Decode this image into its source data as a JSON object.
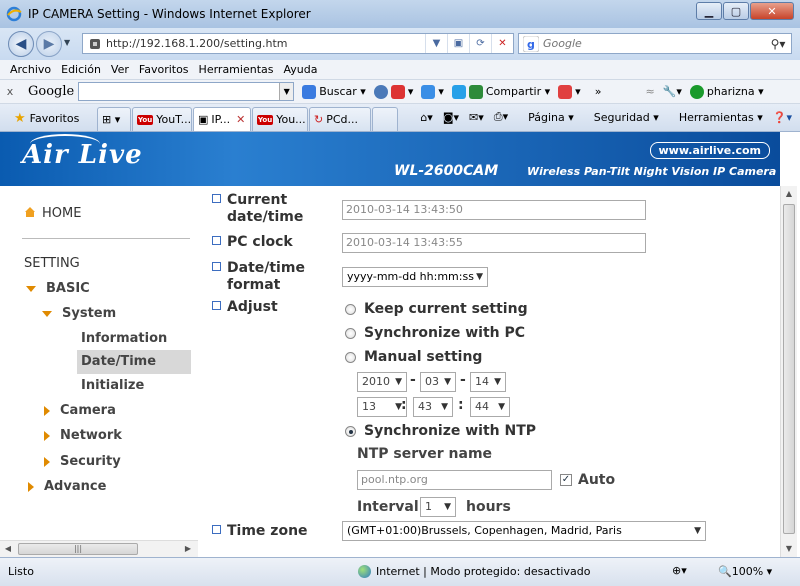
{
  "window": {
    "title": "IP CAMERA Setting - Windows Internet Explorer"
  },
  "address": {
    "url": "http://192.168.1.200/setting.htm",
    "search_placeholder": "Google"
  },
  "menu": [
    "Archivo",
    "Edición",
    "Ver",
    "Favoritos",
    "Herramientas",
    "Ayuda"
  ],
  "google_toolbar": {
    "logo": "Google",
    "buscar": "Buscar",
    "compartir": "Compartir",
    "user": "pharizna"
  },
  "favorites": {
    "label": "Favoritos",
    "tabs": [
      "YouT...",
      "IP...",
      "You...",
      "PCd..."
    ],
    "cmd": [
      "Página",
      "Seguridad",
      "Herramientas"
    ]
  },
  "banner": {
    "logo": "Air Live",
    "site": "www.airlive.com",
    "model": "WL-2600CAM",
    "desc": "Wireless Pan-Tilt Night Vision IP Camera"
  },
  "sidebar": {
    "home": "HOME",
    "setting": "SETTING",
    "basic": "BASIC",
    "system": "System",
    "information": "Information",
    "datetime": "Date/Time",
    "initialize": "Initialize",
    "camera": "Camera",
    "network": "Network",
    "security": "Security",
    "advance": "Advance"
  },
  "form": {
    "current_label_1": "Current",
    "current_label_2": "date/time",
    "current_value": "2010-03-14   13:43:50",
    "pc_label": "PC clock",
    "pc_value": "2010-03-14   13:43:55",
    "format_label_1": "Date/time",
    "format_label_2": "format",
    "format_value": "yyyy-mm-dd hh:mm:ss",
    "adjust_label": "Adjust",
    "opt_keep": "Keep current setting",
    "opt_sync_pc": "Synchronize with PC",
    "opt_manual": "Manual setting",
    "year": "2010",
    "month": "03",
    "day": "14",
    "hour": "13",
    "minute": "43",
    "second": "44",
    "date_sep": "-",
    "time_sep": ":",
    "opt_ntp": "Synchronize with NTP",
    "ntp_server_label": "NTP server name",
    "ntp_placeholder": "pool.ntp.org",
    "auto_label": "Auto",
    "interval_label": "Interval",
    "interval_value": "1",
    "hours_label": "hours",
    "timezone_label": "Time zone",
    "timezone_value": "(GMT+01:00)Brussels, Copenhagen, Madrid, Paris"
  },
  "status": {
    "left": "Listo",
    "zone": "Internet | Modo protegido: desactivado",
    "zoom": "100%"
  },
  "colors": {
    "banner": "#0a5bb0",
    "accent_triangle": "#e08a00",
    "label_box": "#3c6dc0"
  }
}
